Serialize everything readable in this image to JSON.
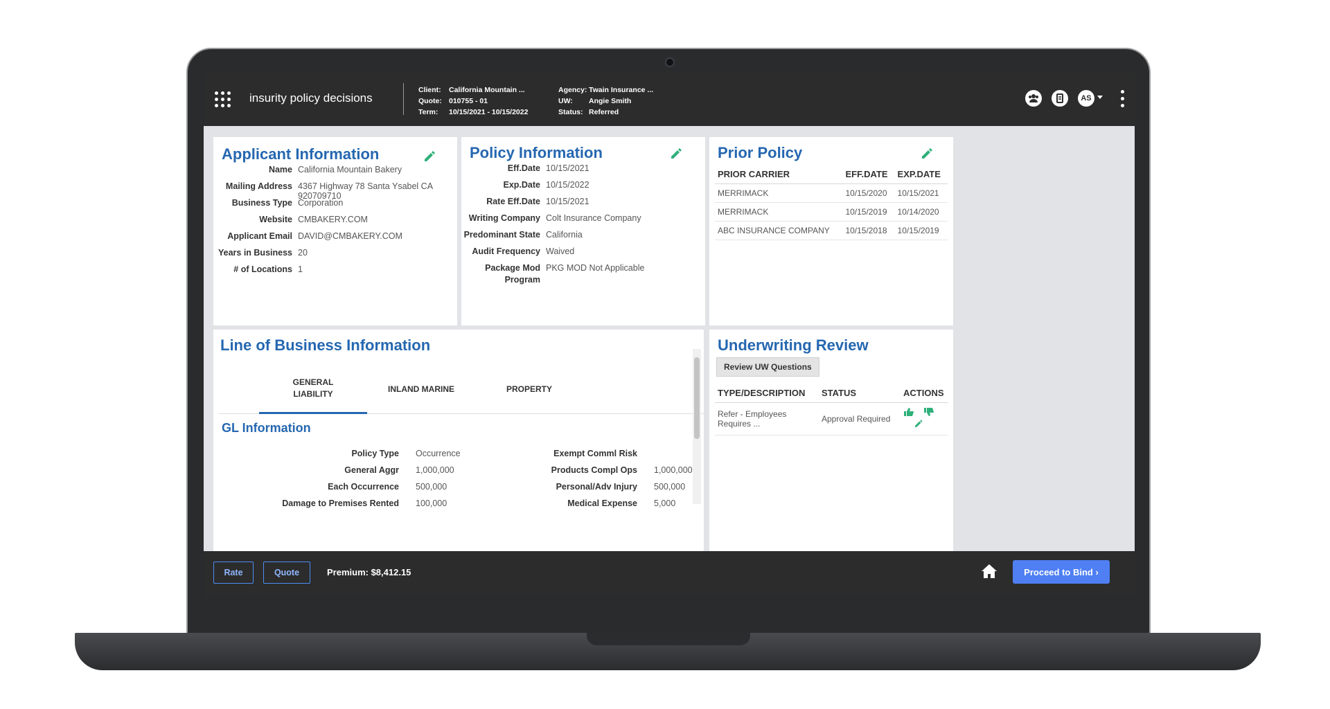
{
  "header": {
    "app_title": "insurity policy decisions",
    "meta_left": [
      {
        "label": "Client:",
        "value": "California Mountain ..."
      },
      {
        "label": "Quote:",
        "value": "010755 - 01"
      },
      {
        "label": "Term:",
        "value": "10/15/2021 - 10/15/2022"
      }
    ],
    "meta_right": [
      {
        "label": "Agency:",
        "value": "Twain Insurance ..."
      },
      {
        "label": "UW:",
        "value": "Angie Smith"
      },
      {
        "label": "Status:",
        "value": "Referred"
      }
    ],
    "user_initials": "AS",
    "icons": [
      "users-icon",
      "notes-icon",
      "avatar",
      "more-icon"
    ]
  },
  "applicant": {
    "title": "Applicant Information",
    "fields": [
      {
        "label": "Name",
        "value": "California Mountain Bakery"
      },
      {
        "label": "Mailing Address",
        "value": "4367 Highway 78 Santa Ysabel CA 920709710"
      },
      {
        "label": "Business Type",
        "value": "Corporation"
      },
      {
        "label": "Website",
        "value": "CMBAKERY.COM"
      },
      {
        "label": "Applicant Email",
        "value": "DAVID@CMBAKERY.COM"
      },
      {
        "label": "Years in Business",
        "value": "20"
      },
      {
        "label": "# of Locations",
        "value": "1"
      }
    ]
  },
  "policy": {
    "title": "Policy Information",
    "fields": [
      {
        "label": "Eff.Date",
        "value": "10/15/2021"
      },
      {
        "label": "Exp.Date",
        "value": "10/15/2022"
      },
      {
        "label": "Rate Eff.Date",
        "value": "10/15/2021"
      },
      {
        "label": "Writing Company",
        "value": "Colt Insurance Company"
      },
      {
        "label": "Predominant State",
        "value": "California"
      },
      {
        "label": "Audit Frequency",
        "value": "Waived"
      },
      {
        "label": "Package Mod",
        "label2": "Program",
        "value": "PKG MOD Not Applicable"
      }
    ]
  },
  "prior_policy": {
    "title": "Prior Policy",
    "columns": [
      "PRIOR CARRIER",
      "EFF.DATE",
      "EXP.DATE"
    ],
    "rows": [
      [
        "MERRIMACK",
        "10/15/2020",
        "10/15/2021"
      ],
      [
        "MERRIMACK",
        "10/15/2019",
        "10/14/2020"
      ],
      [
        "ABC INSURANCE COMPANY",
        "10/15/2018",
        "10/15/2019"
      ]
    ]
  },
  "lob": {
    "title": "Line of Business Information",
    "tabs": [
      {
        "line1": "GENERAL",
        "line2": "LIABILITY",
        "active": true
      },
      {
        "line1": "INLAND MARINE",
        "line2": "",
        "active": false
      },
      {
        "line1": "PROPERTY",
        "line2": "",
        "active": false
      }
    ],
    "gl_title": "GL Information",
    "gl_left": [
      {
        "label": "Policy Type",
        "value": "Occurrence"
      },
      {
        "label": "General Aggr",
        "value": "1,000,000"
      },
      {
        "label": "Each Occurrence",
        "value": "500,000"
      },
      {
        "label": "Damage to Premises Rented",
        "value": "100,000"
      }
    ],
    "gl_right": [
      {
        "label": "Exempt Comml Risk",
        "value": ""
      },
      {
        "label": "Products Compl Ops",
        "value": "1,000,000"
      },
      {
        "label": "Personal/Adv Injury",
        "value": "500,000"
      },
      {
        "label": "Medical Expense",
        "value": "5,000"
      }
    ]
  },
  "uw_review": {
    "title": "Underwriting Review",
    "button": "Review UW Questions",
    "columns": [
      "TYPE/DESCRIPTION",
      "STATUS",
      "ACTIONS"
    ],
    "rows": [
      {
        "description": "Refer - Employees Requires ...",
        "status": "Approval Required"
      }
    ]
  },
  "footer": {
    "rate_label": "Rate",
    "quote_label": "Quote",
    "premium": "Premium: $8,412.15",
    "bind_label": "Proceed to Bind"
  },
  "colors": {
    "accent_blue": "#2567b0",
    "edit_green": "#2fb07a",
    "bind_blue": "#4f7ff3",
    "header_bg": "#2c2c2c"
  }
}
